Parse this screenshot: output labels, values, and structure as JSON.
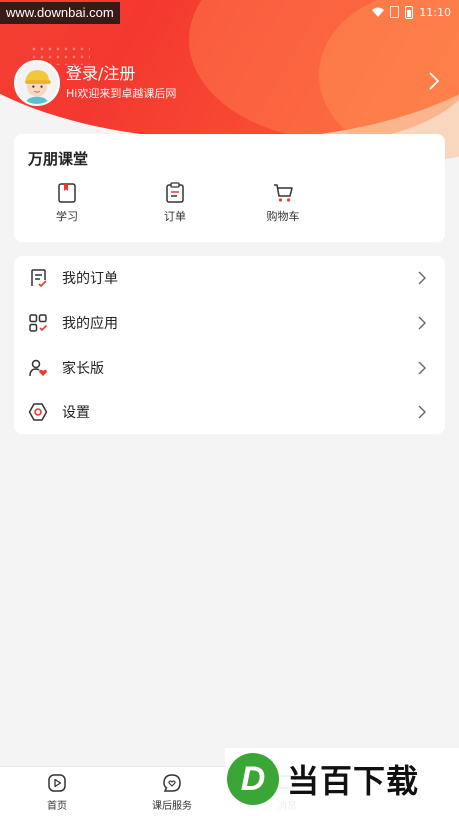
{
  "status_bar": {
    "watermark_url": "www.downbai.com",
    "time": "11:10"
  },
  "profile": {
    "login_label": "登录/注册",
    "welcome": "Hi欢迎来到卓越课后网"
  },
  "classroom": {
    "title": "万朋课堂",
    "shortcuts": [
      {
        "label": "学习",
        "icon": "bookmark-book-icon"
      },
      {
        "label": "订单",
        "icon": "order-list-icon"
      },
      {
        "label": "购物车",
        "icon": "shopping-cart-icon"
      }
    ]
  },
  "menu": {
    "items": [
      {
        "label": "我的订单",
        "icon": "order-check-icon"
      },
      {
        "label": "我的应用",
        "icon": "apps-grid-icon"
      },
      {
        "label": "家长版",
        "icon": "parent-heart-icon"
      },
      {
        "label": "设置",
        "icon": "settings-hexagon-icon"
      }
    ]
  },
  "bottom_nav": {
    "items": [
      {
        "label": "首页",
        "icon": "play-circle-icon"
      },
      {
        "label": "课后服务",
        "icon": "heart-chat-icon"
      },
      {
        "label": "消息",
        "icon": "message-icon"
      }
    ]
  },
  "watermark_logo": {
    "letter": "D",
    "text": "当百下载"
  },
  "colors": {
    "brand_red": "#f4382f",
    "accent_orange": "#ff6a3c",
    "card_bg": "#ffffff",
    "page_bg": "#f4f4f4"
  }
}
